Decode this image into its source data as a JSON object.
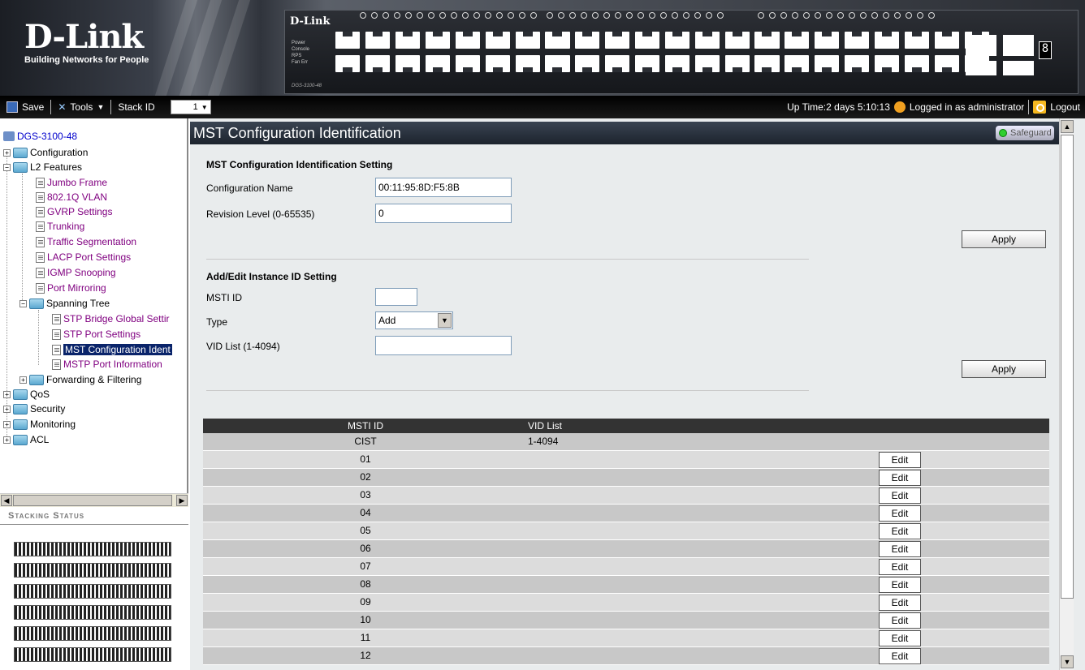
{
  "brand": {
    "name": "D-Link",
    "tagline": "Building Networks for People"
  },
  "device": {
    "name": "D-Link",
    "model": "DGS-3100-48",
    "leds": [
      "Power",
      "Console",
      "RPS",
      "Fan Err"
    ],
    "unit_digit": "8"
  },
  "toolbar": {
    "save_label": "Save",
    "tools_label": "Tools",
    "stack_id_label": "Stack ID",
    "stack_id_value": "1",
    "uptime": "Up Time:2 days 5:10:13",
    "logged_in": "Logged in as administrator",
    "logout_label": "Logout"
  },
  "tree": {
    "root": "DGS-3100-48",
    "configuration": "Configuration",
    "l2_features": "L2 Features",
    "l2_items": [
      "Jumbo Frame",
      "802.1Q VLAN",
      "GVRP Settings",
      "Trunking",
      "Traffic Segmentation",
      "LACP Port Settings",
      "IGMP Snooping",
      "Port Mirroring"
    ],
    "spanning_tree": "Spanning Tree",
    "stp_items": [
      "STP Bridge Global Settir",
      "STP Port Settings",
      "MST Configuration Ident",
      "MSTP Port Information"
    ],
    "forwarding": "Forwarding & Filtering",
    "qos": "QoS",
    "security": "Security",
    "monitoring": "Monitoring",
    "acl": "ACL"
  },
  "stacking_status_label": "Stacking Status",
  "page": {
    "title": "MST Configuration Identification",
    "safeguard_label": "Safeguard"
  },
  "mst_setting": {
    "heading": "MST Configuration Identification Setting",
    "config_name_label": "Configuration Name",
    "config_name_value": "00:11:95:8D:F5:8B",
    "revision_label": "Revision Level (0-65535)",
    "revision_value": "0",
    "apply_label": "Apply"
  },
  "instance_setting": {
    "heading": "Add/Edit Instance ID Setting",
    "msti_label": "MSTI ID",
    "msti_value": "",
    "type_label": "Type",
    "type_value": "Add",
    "vid_label": "VID List (1-4094)",
    "vid_value": "",
    "apply_label": "Apply"
  },
  "table": {
    "columns": [
      "MSTI ID",
      "VID List"
    ],
    "edit_label": "Edit",
    "rows": [
      {
        "id": "CIST",
        "vid": "1-4094",
        "edit": false
      },
      {
        "id": "01",
        "vid": "",
        "edit": true
      },
      {
        "id": "02",
        "vid": "",
        "edit": true
      },
      {
        "id": "03",
        "vid": "",
        "edit": true
      },
      {
        "id": "04",
        "vid": "",
        "edit": true
      },
      {
        "id": "05",
        "vid": "",
        "edit": true
      },
      {
        "id": "06",
        "vid": "",
        "edit": true
      },
      {
        "id": "07",
        "vid": "",
        "edit": true
      },
      {
        "id": "08",
        "vid": "",
        "edit": true
      },
      {
        "id": "09",
        "vid": "",
        "edit": true
      },
      {
        "id": "10",
        "vid": "",
        "edit": true
      },
      {
        "id": "11",
        "vid": "",
        "edit": true
      },
      {
        "id": "12",
        "vid": "",
        "edit": true
      }
    ]
  }
}
